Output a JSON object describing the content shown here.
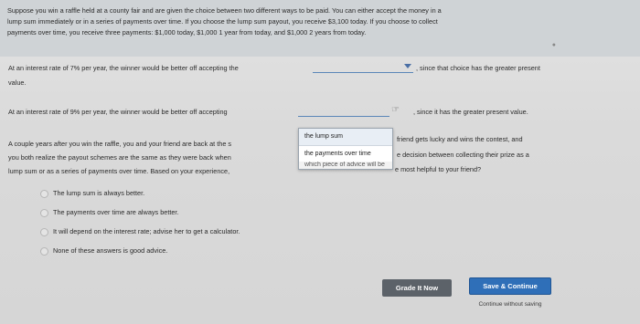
{
  "intro": {
    "line1": "Suppose you win a raffle held at a county fair and are given the choice between two different ways to be paid. You can either accept the money in a",
    "line2": "lump sum immediately or in a series of payments over time. If you choose the lump sum payout, you receive $3,100 today. If you choose to collect",
    "line3": "payments over time, you receive three payments: $1,000 today, $1,000 1 year from today, and $1,000 2 years from today."
  },
  "q1": {
    "prefix": "At an interest rate of 7% per year, the winner would be better off accepting the",
    "suffix": ", since that choice has the greater present",
    "wrap": "value."
  },
  "q2": {
    "prefix": "At an interest rate of 9% per year, the winner would be better off accepting",
    "suffix": ", since it has the greater present value."
  },
  "dropdown_menu": {
    "options": [
      "the lump sum",
      "the payments over time"
    ],
    "partial_option": "which piece of advice will be"
  },
  "q3": {
    "line1": "A couple years after you win the raffle, you and your friend are back at the s",
    "line1_right": "friend gets lucky and wins the contest, and",
    "line2": "you both realize the payout schemes are the same as they were back when",
    "line2_right": "e decision between collecting their prize as a",
    "line3": "lump sum or as a series of payments over time. Based on your experience,",
    "line3_right": "e most helpful to your friend?"
  },
  "answers": [
    "The lump sum is always better.",
    "The payments over time are always better.",
    "It will depend on the interest rate; advise her to get a calculator.",
    "None of these answers is good advice."
  ],
  "buttons": {
    "grade": "Grade It Now",
    "save": "Save & Continue",
    "continue": "Continue without saving"
  }
}
